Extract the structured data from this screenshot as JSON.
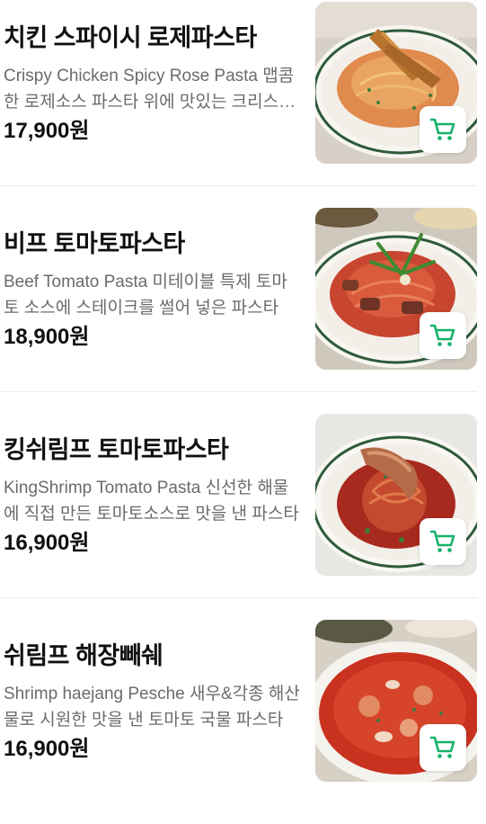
{
  "accent_color": "#17b26a",
  "menu": {
    "items": [
      {
        "name": "치킨 스파이시 로제파스타",
        "description": "Crispy Chicken Spicy Rose Pasta 맵콤한 로제소스 파스타 위에 맛있는 크리스피 치킨을 올린 파스타",
        "price": "17,900원",
        "image_icon": "rose-pasta-photo",
        "cart_icon": "cart-icon"
      },
      {
        "name": "비프 토마토파스타",
        "description": "Beef Tomato Pasta 미테이블 특제 토마토 소스에 스테이크를 썰어 넣은 파스타",
        "price": "18,900원",
        "image_icon": "tomato-pasta-photo",
        "cart_icon": "cart-icon"
      },
      {
        "name": "킹쉬림프 토마토파스타",
        "description": "KingShrimp Tomato Pasta 신선한 해물에 직접 만든 토마토소스로 맛을 낸 파스타",
        "price": "16,900원",
        "image_icon": "shrimp-pasta-photo",
        "cart_icon": "cart-icon"
      },
      {
        "name": "쉬림프 해장빼쉐",
        "description": "Shrimp haejang Pesche 새우&각종 해산물로 시원한 맛을 낸 토마토 국물 파스타",
        "price": "16,900원",
        "image_icon": "pesche-stew-photo",
        "cart_icon": "cart-icon"
      }
    ]
  }
}
